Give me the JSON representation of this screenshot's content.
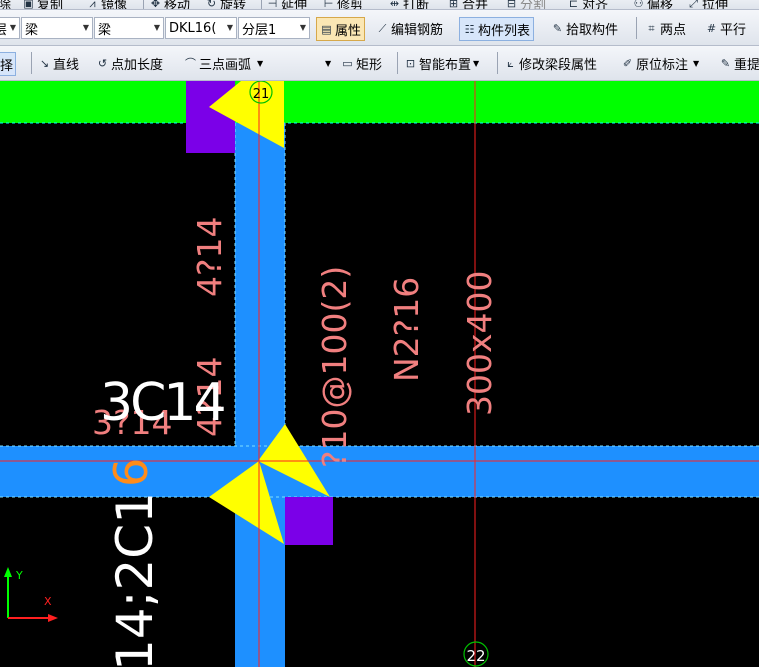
{
  "toolbar_top": {
    "items": [
      {
        "icon": "delete-icon",
        "label": "除"
      },
      {
        "icon": "copy-icon",
        "label": "复制"
      },
      {
        "icon": "mirror-icon",
        "label": "镜像"
      },
      {
        "icon": "move-icon",
        "label": "移动"
      },
      {
        "icon": "rotate-icon",
        "label": "旋转"
      },
      {
        "icon": "extend-icon",
        "label": "延伸"
      },
      {
        "icon": "trim-icon",
        "label": "修剪"
      },
      {
        "icon": "break-icon",
        "label": "打断"
      },
      {
        "icon": "merge-icon",
        "label": "合并"
      },
      {
        "icon": "split-icon",
        "label": "分割"
      },
      {
        "icon": "align-icon",
        "label": "对齐"
      },
      {
        "icon": "offset-icon",
        "label": "偏移"
      },
      {
        "icon": "stretch-icon",
        "label": "拉伸"
      }
    ]
  },
  "toolbar_mid": {
    "select_type_value": "梁",
    "select_sub_value": "梁",
    "select_element_value": "DKL16(",
    "select_layer_value": "分层1",
    "first_label": "层",
    "properties_label": "属性",
    "edit_rebar_label": "编辑钢筋",
    "component_list_label": "构件列表",
    "pick_component_label": "拾取构件",
    "two_points_label": "两点",
    "parallel_label": "平行"
  },
  "toolbar_bottom": {
    "select_label": "择",
    "line_label": "直线",
    "point_length_label": "点加长度",
    "arc_label": "三点画弧",
    "rect_label": "矩形",
    "smart_layout_label": "智能布置",
    "modify_span_label": "修改梁段属性",
    "in_situ_label": "原位标注",
    "reextract_label": "重提"
  },
  "drawing": {
    "axis_top": "21",
    "axis_bottom": "22",
    "ucs_y": "Y",
    "ucs_x": "X",
    "annotations": [
      {
        "id": "a1",
        "text": "4?14"
      },
      {
        "id": "a2",
        "text": "4?14"
      },
      {
        "id": "a3",
        "text": "3C14"
      },
      {
        "id": "a4",
        "text": "3?14"
      },
      {
        "id": "a5",
        "text": "?10@100(2)"
      },
      {
        "id": "a6",
        "text": "N2?16"
      },
      {
        "id": "a7",
        "text": "300x400"
      },
      {
        "id": "a8",
        "text": "14;2C1"
      },
      {
        "id": "a9",
        "text": "6"
      }
    ],
    "colors": {
      "background": "#000000",
      "beam_green": "#00ff00",
      "beam_blue": "#1e90ff",
      "column_purple": "#7b00e8",
      "grip_yellow": "#ffff00",
      "annotation_pink": "#f07f7f",
      "annotation_white": "#ffffff",
      "annotation_orange": "#ff8c1a",
      "axis_red": "#ff2020",
      "axis_circle": "#00c000"
    }
  }
}
